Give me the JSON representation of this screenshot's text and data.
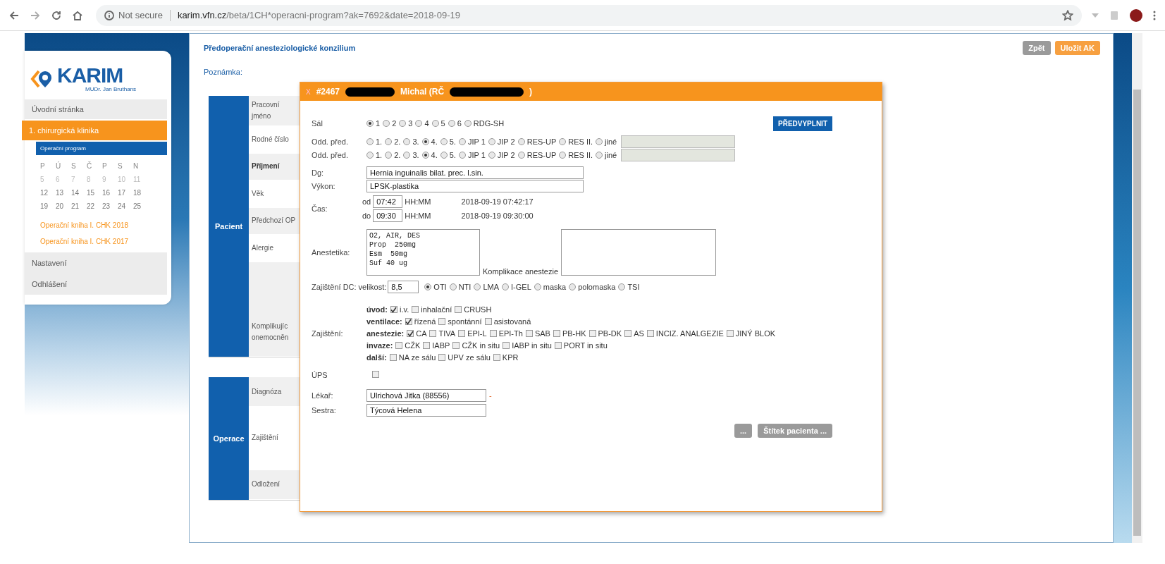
{
  "browser": {
    "security": "Not secure",
    "url_host": "karim.vfn.cz",
    "url_path": "/beta/1CH*operacni-program?ak=7692&date=2018-09-19"
  },
  "sidebar": {
    "logo": "KARIM",
    "subtitle": "MUDr. Jan Bruthans",
    "nav": [
      {
        "label": "Úvodní stránka",
        "kind": "page",
        "selected": false
      },
      {
        "label": "1. chirurgická klinika",
        "kind": "clinic",
        "selected": true
      },
      {
        "label": "Operační program",
        "kind": "sub",
        "selected": true
      }
    ],
    "calendar": {
      "weekdays": [
        "P",
        "Ú",
        "S",
        "Č",
        "P",
        "S",
        "N"
      ],
      "weeks": [
        {
          "days": [
            "5",
            "6",
            "7",
            "8",
            "9",
            "10",
            "11"
          ],
          "muted": true
        },
        {
          "days": [
            "12",
            "13",
            "14",
            "15",
            "16",
            "17",
            "18"
          ],
          "muted": false
        },
        {
          "days": [
            "19",
            "20",
            "21",
            "22",
            "23",
            "24",
            "25"
          ],
          "muted": false
        }
      ]
    },
    "links": [
      "Operační kniha I. CHK 2018",
      "Operační kniha I. CHK 2017"
    ],
    "footer_nav": [
      "Nastavení",
      "Odhlášení"
    ]
  },
  "main": {
    "title": "Předoperační anesteziologické konzilium",
    "note_label": "Poznámka:",
    "buttons": [
      {
        "label": "Zpět",
        "kind": "secondary"
      },
      {
        "label": "Uložit AK",
        "kind": "primary"
      }
    ],
    "sections": [
      {
        "label": "Pacient",
        "rows": [
          "Pracovní jméno",
          "Rodné číslo",
          "Příjmení",
          "Věk",
          "Předchozí OP",
          "Alergie",
          "Komplikujíc onemocněn"
        ]
      },
      {
        "label": "Operace",
        "rows": [
          "Diagnóza",
          "Zajištění",
          "Odložení"
        ]
      }
    ]
  },
  "dialog": {
    "close": "X",
    "title_parts": [
      {
        "kind": "text",
        "text": "#2467"
      },
      {
        "kind": "redacted"
      },
      {
        "kind": "text",
        "text": "Michal (RČ"
      },
      {
        "kind": "redacted"
      },
      {
        "kind": "text",
        "text": ")"
      }
    ],
    "prefill_button": "PŘEDVYPLNIT",
    "hall": {
      "label": "Sál",
      "options": [
        {
          "label": "1",
          "selected": true
        },
        {
          "label": "2",
          "selected": false
        },
        {
          "label": "3",
          "selected": false
        },
        {
          "label": "4",
          "selected": false
        },
        {
          "label": "5",
          "selected": false
        },
        {
          "label": "6",
          "selected": false
        },
        {
          "label": "RDG-SH",
          "selected": false
        }
      ]
    },
    "departments": [
      {
        "label": "Odd. před.",
        "options": [
          {
            "label": "1.",
            "selected": false
          },
          {
            "label": "2.",
            "selected": false
          },
          {
            "label": "3.",
            "selected": false
          },
          {
            "label": "4.",
            "selected": true
          },
          {
            "label": "5.",
            "selected": false
          },
          {
            "label": "JIP 1",
            "selected": false
          },
          {
            "label": "JIP 2",
            "selected": false
          },
          {
            "label": "RES-UP",
            "selected": false
          },
          {
            "label": "RES II.",
            "selected": false
          },
          {
            "label": "jiné",
            "selected": false
          }
        ]
      },
      {
        "label": "Odd. před.",
        "options": [
          {
            "label": "1.",
            "selected": false
          },
          {
            "label": "2.",
            "selected": false
          },
          {
            "label": "3.",
            "selected": false
          },
          {
            "label": "4.",
            "selected": true
          },
          {
            "label": "5.",
            "selected": false
          },
          {
            "label": "JIP 1",
            "selected": false
          },
          {
            "label": "JIP 2",
            "selected": false
          },
          {
            "label": "RES-UP",
            "selected": false
          },
          {
            "label": "RES II.",
            "selected": false
          },
          {
            "label": "jiné",
            "selected": false
          }
        ]
      }
    ],
    "diagnosis": {
      "label": "Dg:",
      "value": "Hernia inguinalis bilat. prec. l.sin."
    },
    "procedure": {
      "label": "Výkon:",
      "value": "LPSK-plastika"
    },
    "time": {
      "label": "Čas:",
      "rows": [
        {
          "prefix": "od",
          "value": "07:42",
          "format": "HH:MM",
          "stamp": "2018-09-19 07:42:17"
        },
        {
          "prefix": "do",
          "value": "09:30",
          "format": "HH:MM",
          "stamp": "2018-09-19 09:30:00"
        }
      ]
    },
    "anesthetics": {
      "label": "Anestetika:",
      "value": "O2, AIR, DES\nProp  250mg\nEsm  50mg\nSuf 40 ug",
      "complications_label": "Komplikace anestezie"
    },
    "airway": {
      "label": "Zajištění DC:",
      "size_label": "velikost:",
      "size": "8,5",
      "options": [
        {
          "label": "OTI",
          "selected": true
        },
        {
          "label": "NTI",
          "selected": false
        },
        {
          "label": "LMA",
          "selected": false
        },
        {
          "label": "I-GEL",
          "selected": false
        },
        {
          "label": "maska",
          "selected": false
        },
        {
          "label": "polomaska",
          "selected": false
        },
        {
          "label": "TSI",
          "selected": false
        }
      ]
    },
    "security": {
      "label": "Zajištění:",
      "groups": [
        {
          "label": "úvod:",
          "items": [
            {
              "label": "i.v.",
              "checked": true
            },
            {
              "label": "inhalační",
              "checked": false
            },
            {
              "label": "CRUSH",
              "checked": false
            }
          ]
        },
        {
          "label": "ventilace:",
          "items": [
            {
              "label": "řízená",
              "checked": true
            },
            {
              "label": "spontánní",
              "checked": false
            },
            {
              "label": "asistovaná",
              "checked": false
            }
          ]
        },
        {
          "label": "anestezie:",
          "items": [
            {
              "label": "CA",
              "checked": true
            },
            {
              "label": "TIVA",
              "checked": false
            },
            {
              "label": "EPI-L",
              "checked": false
            },
            {
              "label": "EPI-Th",
              "checked": false
            },
            {
              "label": "SAB",
              "checked": false
            },
            {
              "label": "PB-HK",
              "checked": false
            },
            {
              "label": "PB-DK",
              "checked": false
            },
            {
              "label": "AS",
              "checked": false
            },
            {
              "label": "INCIZ. ANALGEZIE",
              "checked": false
            },
            {
              "label": "JINÝ BLOK",
              "checked": false
            }
          ]
        },
        {
          "label": "invaze:",
          "items": [
            {
              "label": "CŽK",
              "checked": false
            },
            {
              "label": "IABP",
              "checked": false
            },
            {
              "label": "CŽK in situ",
              "checked": false
            },
            {
              "label": "IABP in situ",
              "checked": false
            },
            {
              "label": "PORT in situ",
              "checked": false
            }
          ]
        },
        {
          "label": "další:",
          "items": [
            {
              "label": "NA ze sálu",
              "checked": false
            },
            {
              "label": "UPV ze sálu",
              "checked": false
            },
            {
              "label": "KPR",
              "checked": false
            }
          ]
        }
      ]
    },
    "ups": {
      "label": "ÚPS",
      "checked": false
    },
    "doctor": {
      "label": "Lékař:",
      "value": "Ulrichová Jitka (88556)",
      "marker": "-"
    },
    "nurse": {
      "label": "Sestra:",
      "value": "Týcová Helena"
    },
    "buttons": [
      "...",
      "Štítek pacienta ..."
    ]
  }
}
